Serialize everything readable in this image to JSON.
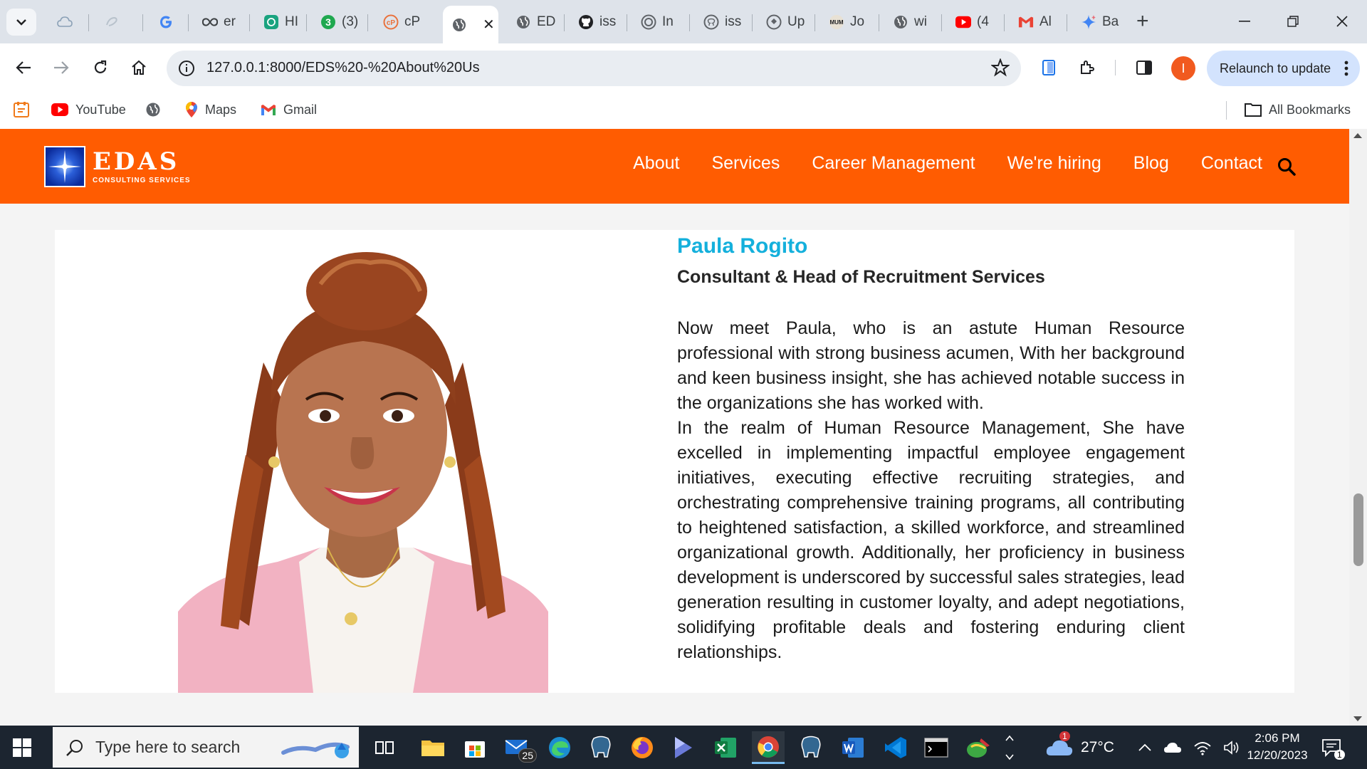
{
  "browser": {
    "tabs": [
      {
        "label": "",
        "icon": "cloud-icon"
      },
      {
        "label": "",
        "icon": "swirl-icon"
      },
      {
        "label": "",
        "icon": "google-icon"
      },
      {
        "label": "er",
        "icon": "infinity-icon"
      },
      {
        "label": "HI",
        "icon": "chatgpt-icon"
      },
      {
        "label": "(3)",
        "icon": "green-3-icon"
      },
      {
        "label": "cP",
        "icon": "cpanel-icon"
      },
      {
        "label": "",
        "icon": "globe-icon",
        "active": true
      },
      {
        "label": "ED",
        "icon": "globe-icon"
      },
      {
        "label": "iss",
        "icon": "github-icon"
      },
      {
        "label": "In",
        "icon": "target-icon"
      },
      {
        "label": "iss",
        "icon": "github-icon"
      },
      {
        "label": "Up",
        "icon": "upwork-icon"
      },
      {
        "label": "Jo",
        "icon": "mum-icon"
      },
      {
        "label": "wi",
        "icon": "globe-icon"
      },
      {
        "label": "(4",
        "icon": "youtube-icon"
      },
      {
        "label": "Al",
        "icon": "gmail-icon"
      },
      {
        "label": "Ba",
        "icon": "bard-icon"
      }
    ],
    "url": "127.0.0.1:8000/EDS%20-%20About%20Us",
    "relaunch_label": "Relaunch to update",
    "profile_initial": "I",
    "bookmarks": [
      {
        "label": "",
        "icon": "apps-icon"
      },
      {
        "label": "YouTube",
        "icon": "youtube-icon"
      },
      {
        "label": "",
        "icon": "globe-icon"
      },
      {
        "label": "Maps",
        "icon": "maps-pin-icon"
      },
      {
        "label": "Gmail",
        "icon": "gmail-icon"
      }
    ],
    "all_bookmarks": "All Bookmarks"
  },
  "site": {
    "brand": "EDAS",
    "brand_sub": "CONSULTING SERVICES",
    "nav": [
      "About",
      "Services",
      "Career Management",
      "We're hiring",
      "Blog",
      "Contact"
    ],
    "accent": "#ff5c01"
  },
  "profile": {
    "name": "Paula Rogito",
    "title": "Consultant & Head of Recruitment Services",
    "para1": "Now meet Paula, who is an astute Human Resource professional with strong business acumen, With her background and keen business insight, she has achieved notable success in the organizations she has worked with.",
    "para2": "In the realm of Human Resource Management, She have excelled in implementing impactful employee engagement initiatives, executing effective recruiting strategies, and orchestrating comprehensive training programs, all contributing to heightened satisfaction, a skilled workforce, and streamlined organizational growth. Additionally, her proficiency in business development is underscored by successful sales strategies, lead generation resulting in customer loyalty, and adept negotiations, solidifying profitable deals and fostering enduring client relationships."
  },
  "taskbar": {
    "search_placeholder": "Type here to search",
    "mail_badge": "25",
    "weather": "27°C",
    "weather_badge": "1",
    "time": "2:06 PM",
    "date": "12/20/2023",
    "notif_count": "1"
  }
}
